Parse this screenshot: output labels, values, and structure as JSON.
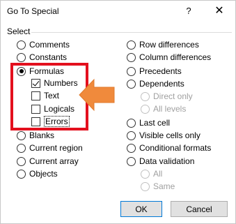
{
  "dialog": {
    "title": "Go To Special",
    "help_label": "?",
    "close_label": "✕",
    "group_label": "Select"
  },
  "left_options": {
    "comments": "Comments",
    "constants": "Constants",
    "formulas": "Formulas",
    "numbers": "Numbers",
    "text": "Text",
    "logicals": "Logicals",
    "errors": "Errors",
    "blanks": "Blanks",
    "current_region": "Current region",
    "current_array": "Current array",
    "objects": "Objects"
  },
  "right_options": {
    "row_differences": "Row differences",
    "column_differences": "Column differences",
    "precedents": "Precedents",
    "dependents": "Dependents",
    "direct_only": "Direct only",
    "all_levels": "All levels",
    "last_cell": "Last cell",
    "visible_cells_only": "Visible cells only",
    "conditional_formats": "Conditional formats",
    "data_validation": "Data validation",
    "all": "All",
    "same": "Same"
  },
  "buttons": {
    "ok": "OK",
    "cancel": "Cancel"
  },
  "state": {
    "selected_radio": "formulas",
    "numbers_checked": true,
    "text_checked": false,
    "logicals_checked": false,
    "errors_checked": false
  },
  "colors": {
    "highlight_box": "#e3101e",
    "arrow_fill": "#f08a3c"
  }
}
